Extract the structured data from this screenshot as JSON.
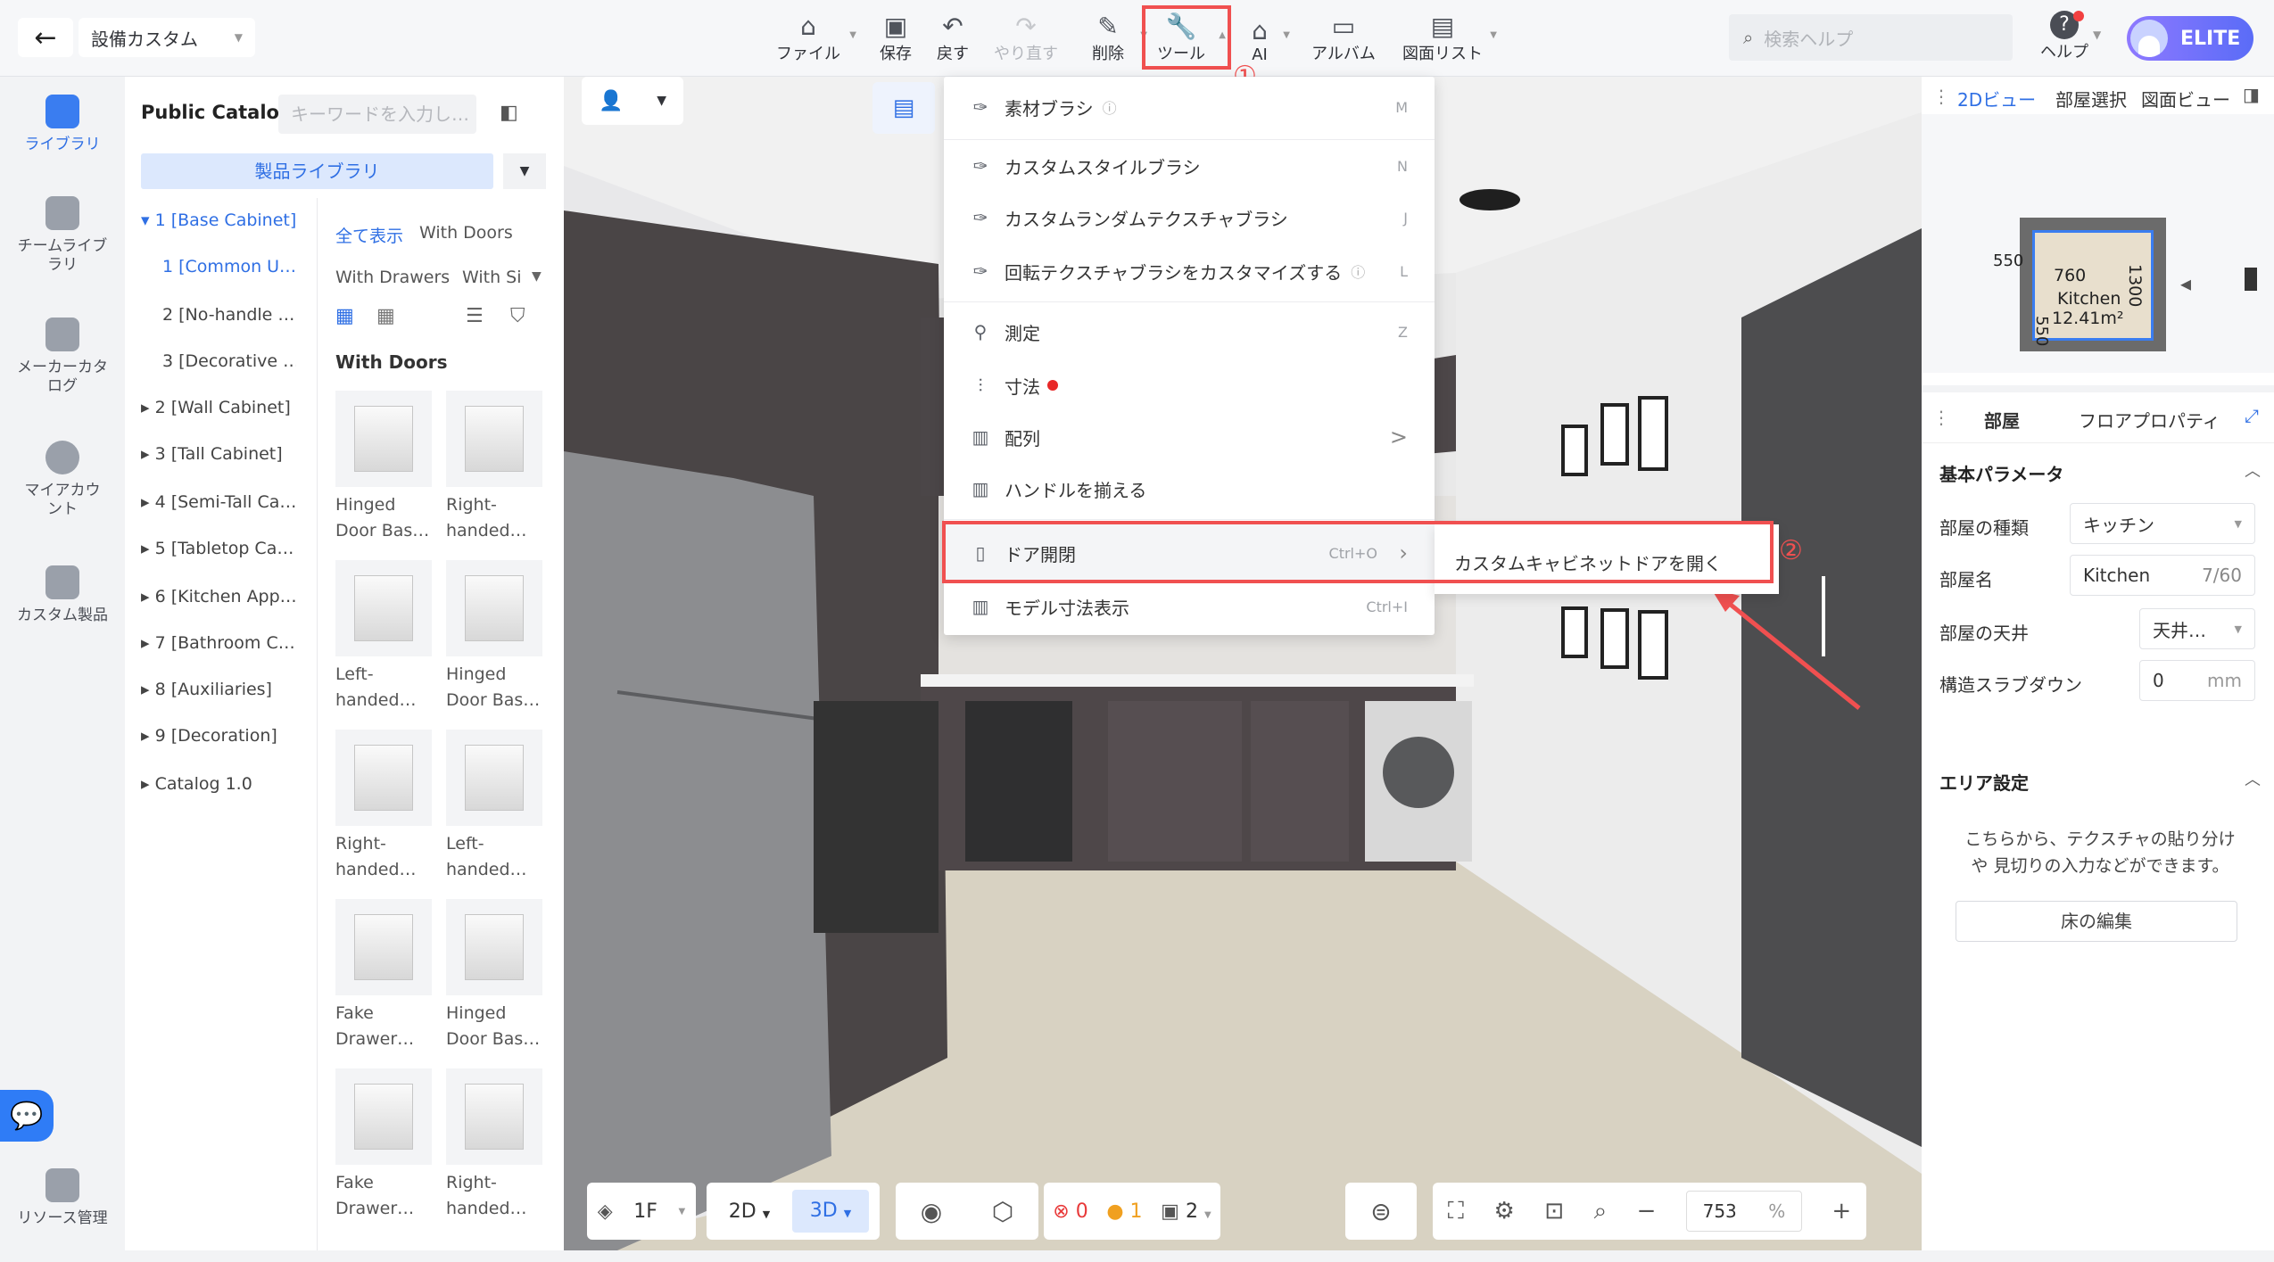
{
  "topbar": {
    "back_icon": "arrow-left-icon",
    "project_name": "設備カスタム",
    "toolbar": [
      {
        "label": "ファイル",
        "icon": "home-icon"
      },
      {
        "label": "保存",
        "icon": "save-icon"
      },
      {
        "label": "戻す",
        "icon": "undo-icon"
      },
      {
        "label": "やり直す",
        "icon": "redo-icon"
      },
      {
        "label": "削除",
        "icon": "eraser-icon"
      },
      {
        "label": "ツール",
        "icon": "wrench-icon"
      },
      {
        "label": "AI",
        "icon": "ai-house-icon"
      },
      {
        "label": "アルバム",
        "icon": "album-icon"
      },
      {
        "label": "図面リスト",
        "icon": "drawing-list-icon"
      }
    ],
    "search_placeholder": "検索ヘルプ",
    "help_label": "ヘルプ",
    "elite_label": "ELITE",
    "annotation_1": "①",
    "annotation_2": "②"
  },
  "leftnav": [
    {
      "label": "ライブラリ",
      "icon": "library-icon"
    },
    {
      "label": "チームライブラリ",
      "icon": "team-library-icon"
    },
    {
      "label": "メーカーカタログ",
      "icon": "maker-catalog-icon"
    },
    {
      "label": "マイアカウント",
      "icon": "account-icon"
    },
    {
      "label": "カスタム製品",
      "icon": "custom-product-icon"
    },
    {
      "label": "リソース管理",
      "icon": "resource-icon"
    }
  ],
  "catalog": {
    "title": "Public Catalog",
    "search_placeholder": "キーワードを入力し…",
    "library_button": "製品ライブラリ",
    "tree": [
      "▾ 1 [Base Cabinet]",
      "1 [Common U…",
      "2 [No-handle …",
      "3 [Decorative …",
      "▸ 2 [Wall Cabinet]",
      "▸ 3 [Tall Cabinet]",
      "▸ 4 [Semi-Tall Ca…",
      "▸ 5 [Tabletop Ca…",
      "▸ 6 [Kitchen App…",
      "▸ 7 [Bathroom C…",
      "▸ 8 [Auxiliaries]",
      "▸ 9 [Decoration]",
      "▸ Catalog 1.0"
    ],
    "filters": {
      "all": "全て表示",
      "doors": "With Doors",
      "drawers": "With Drawers",
      "si": "With Si"
    },
    "group_title": "With Doors",
    "products": [
      {
        "l1": "Hinged",
        "l2": "Door Bas…"
      },
      {
        "l1": "Right-",
        "l2": "handed…"
      },
      {
        "l1": "Left-",
        "l2": "handed…"
      },
      {
        "l1": "Hinged",
        "l2": "Door Bas…"
      },
      {
        "l1": "Right-",
        "l2": "handed…"
      },
      {
        "l1": "Left-",
        "l2": "handed…"
      },
      {
        "l1": "Fake",
        "l2": "Drawer…"
      },
      {
        "l1": "Hinged",
        "l2": "Door Bas…"
      },
      {
        "l1": "Fake",
        "l2": "Drawer…"
      },
      {
        "l1": "Right-",
        "l2": "handed…"
      }
    ]
  },
  "menu": {
    "items": [
      {
        "label": "素材ブラシ",
        "shortcut": "M",
        "info": "ⓘ"
      },
      {
        "label": "カスタムスタイルブラシ",
        "shortcut": "N"
      },
      {
        "label": "カスタムランダムテクスチャブラシ",
        "shortcut": "J"
      },
      {
        "label": "回転テクスチャブラシをカスタマイズする",
        "shortcut": "L",
        "info": "ⓘ"
      },
      {
        "label": "測定",
        "shortcut": "Z"
      },
      {
        "label": "寸法",
        "shortcut": ""
      },
      {
        "label": "配列",
        "shortcut": ">"
      },
      {
        "label": "ハンドルを揃える",
        "shortcut": ""
      },
      {
        "label": "ドア開閉",
        "shortcut": "Ctrl+O"
      },
      {
        "label": "モデル寸法表示",
        "shortcut": "Ctrl+I"
      }
    ],
    "submenu_item": "カスタムキャビネットドアを開く"
  },
  "rightpanel": {
    "view_tabs": [
      "2Dビュー",
      "部屋選択",
      "図面ビュー"
    ],
    "minimap": {
      "dim_top": "760",
      "dim_right": "1300",
      "dim_left_top": "550",
      "dim_left_bottom": "550",
      "room_name": "Kitchen",
      "room_area": "12.41m²"
    },
    "tabs": [
      "部屋",
      "フロアプロパティ"
    ],
    "section_basic": "基本パラメータ",
    "room_type_label": "部屋の種類",
    "room_type_value": "キッチン",
    "room_name_label": "部屋名",
    "room_name_value": "Kitchen",
    "room_name_count": "7/60",
    "ceiling_label": "部屋の天井",
    "ceiling_value": "天井…",
    "slab_label": "構造スラブダウン",
    "slab_value": "0",
    "slab_unit": "mm",
    "section_area": "エリア設定",
    "area_hint_1": "こちらから、テクスチャの貼り分け",
    "area_hint_2": "や 見切りの入力などができます。",
    "floor_edit_button": "床の編集"
  },
  "bottombar": {
    "floor": "1F",
    "view_2d": "2D",
    "view_3d": "3D",
    "errors": "0",
    "warnings": "1",
    "layers": "2",
    "zoom": "753",
    "zoom_unit": "%"
  },
  "colors": {
    "accent": "#2f6fe4",
    "annotation_red": "#f05050"
  }
}
